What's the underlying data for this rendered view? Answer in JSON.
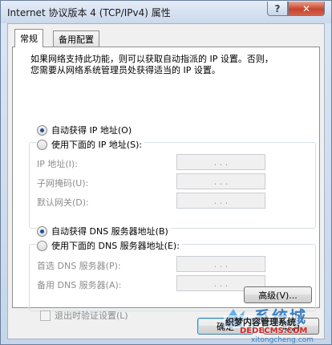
{
  "window": {
    "title": "Internet 协议版本 4 (TCP/IPv4) 属性",
    "help_label": "?",
    "close_label": "✕"
  },
  "tabs": [
    {
      "label": "常规",
      "active": true
    },
    {
      "label": "备用配置",
      "active": false
    }
  ],
  "general": {
    "description_line1": "如果网络支持此功能，则可以获取自动指派的 IP 设置。否则，",
    "description_line2": "您需要从网络系统管理员处获得适当的 IP 设置。",
    "ip_auto_label": "自动获得 IP 地址(O)",
    "ip_manual_label": "使用下面的 IP 地址(S):",
    "ip_fields": [
      {
        "label": "IP 地址(I):",
        "value": ". . ."
      },
      {
        "label": "子网掩码(U):",
        "value": ". . ."
      },
      {
        "label": "默认网关(D):",
        "value": ". . ."
      }
    ],
    "dns_auto_label": "自动获得 DNS 服务器地址(B)",
    "dns_manual_label": "使用下面的 DNS 服务器地址(E):",
    "dns_fields": [
      {
        "label": "首选 DNS 服务器(P):",
        "value": ". . ."
      },
      {
        "label": "备用 DNS 服务器(A):",
        "value": ". . ."
      }
    ],
    "validate_label": "退出时验证设置(L)",
    "advanced_label": "高级(V)..."
  },
  "footer": {
    "ok_label": "确定",
    "cancel_label": "取消"
  },
  "watermark": {
    "brand": "系统城",
    "site_cn": "织梦内容管理系统",
    "site_en": "DEDECMS.COM",
    "domain": "xitongcheng.com"
  }
}
